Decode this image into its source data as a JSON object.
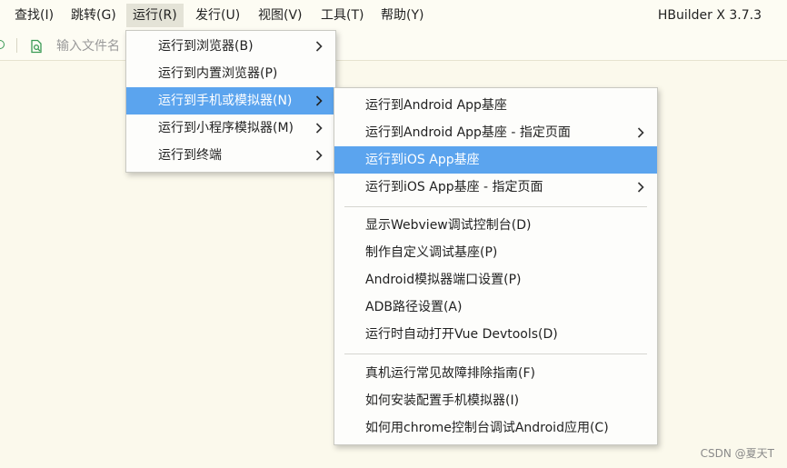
{
  "menubar": {
    "items": [
      {
        "label": "查找(I)"
      },
      {
        "label": "跳转(G)"
      },
      {
        "label": "运行(R)"
      },
      {
        "label": "发行(U)"
      },
      {
        "label": "视图(V)"
      },
      {
        "label": "工具(T)"
      },
      {
        "label": "帮助(Y)"
      }
    ],
    "app_title": "HBuilder X 3.7.3"
  },
  "toolbar": {
    "search_placeholder": "输入文件名"
  },
  "run_menu": {
    "items": [
      {
        "label": "运行到浏览器(B)",
        "has_submenu": true
      },
      {
        "label": "运行到内置浏览器(P)",
        "has_submenu": false
      },
      {
        "label": "运行到手机或模拟器(N)",
        "has_submenu": true,
        "highlighted": true
      },
      {
        "label": "运行到小程序模拟器(M)",
        "has_submenu": true
      },
      {
        "label": "运行到终端",
        "has_submenu": true
      }
    ]
  },
  "device_submenu": {
    "group1": [
      {
        "label": "运行到Android App基座",
        "has_submenu": false
      },
      {
        "label": "运行到Android App基座 - 指定页面",
        "has_submenu": true
      },
      {
        "label": "运行到iOS App基座",
        "has_submenu": false,
        "highlighted": true
      },
      {
        "label": "运行到iOS App基座 - 指定页面",
        "has_submenu": true
      }
    ],
    "group2": [
      {
        "label": "显示Webview调试控制台(D)"
      },
      {
        "label": "制作自定义调试基座(P)"
      },
      {
        "label": "Android模拟器端口设置(P)"
      },
      {
        "label": "ADB路径设置(A)"
      },
      {
        "label": "运行时自动打开Vue Devtools(D)"
      }
    ],
    "group3": [
      {
        "label": "真机运行常见故障排除指南(F)"
      },
      {
        "label": "如何安装配置手机模拟器(I)"
      },
      {
        "label": "如何用chrome控制台调试Android应用(C)"
      }
    ]
  },
  "watermark": "CSDN @夏天T",
  "colors": {
    "highlight": "#5ba4ee",
    "background": "#fbf9ec",
    "active_menu_bg": "#e4e3d7"
  }
}
